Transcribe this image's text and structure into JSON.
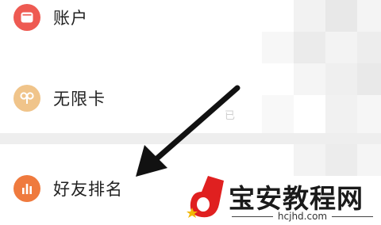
{
  "menu": {
    "items": [
      {
        "label": "账户",
        "icon": "wallet-icon",
        "color": "#ee5a52"
      },
      {
        "label": "无限卡",
        "icon": "infinity-card-icon",
        "color": "#f0c48a"
      },
      {
        "label": "好友排名",
        "icon": "bar-chart-icon",
        "color": "#ef7a3e"
      }
    ]
  },
  "background_text": "已",
  "watermark": {
    "title": "宝安教程网",
    "url": "hcjhd.com",
    "colors": {
      "logo_red": "#e02020",
      "star": "#f2b705"
    }
  }
}
